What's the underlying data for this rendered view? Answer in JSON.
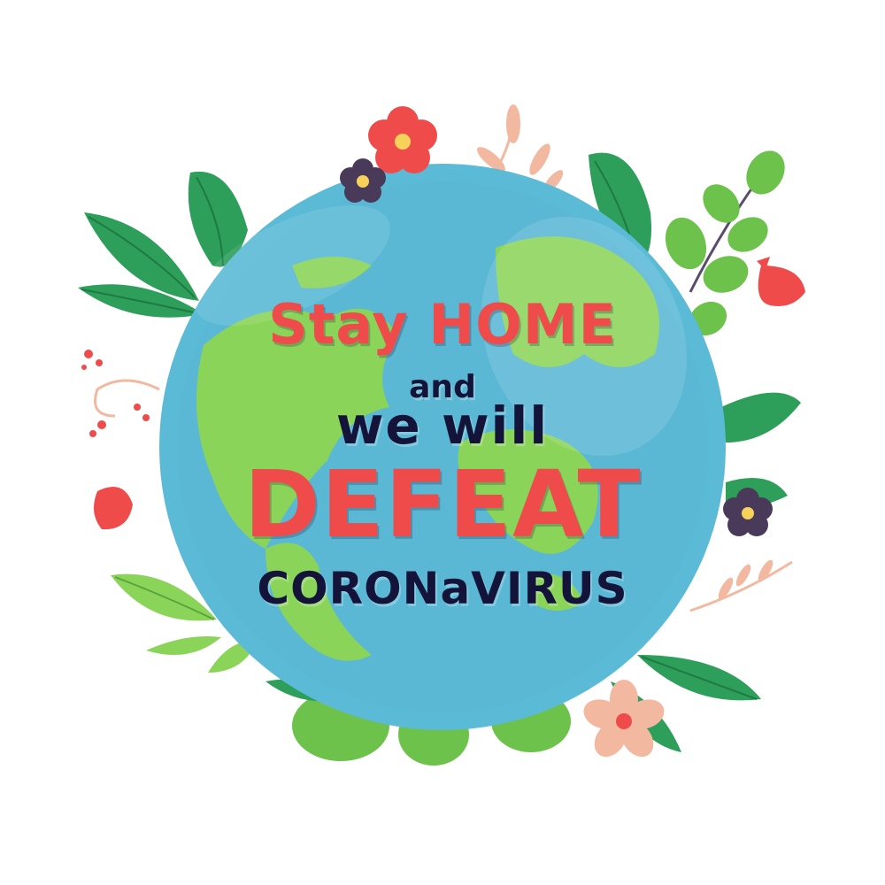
{
  "poster": {
    "line1": "Stay HOME",
    "line2": "and",
    "line3": "we will",
    "line4": "DEFEAT",
    "line5": "CORONaVIRUS"
  },
  "colors": {
    "background": "#ffffff",
    "ocean": "#5bbad6",
    "land": "#8bd45a",
    "leaf_dark": "#2e9e5b",
    "leaf_light": "#6cc24a",
    "flower_red": "#ef4b4b",
    "flower_dark": "#4a3a5a",
    "flower_peach": "#f2b9a0",
    "text_red": "#ef4b4b",
    "text_navy": "#14143a"
  },
  "icons": [
    "globe-icon",
    "leaf-icon",
    "flower-icon",
    "fern-icon",
    "berry-sprig-icon"
  ]
}
